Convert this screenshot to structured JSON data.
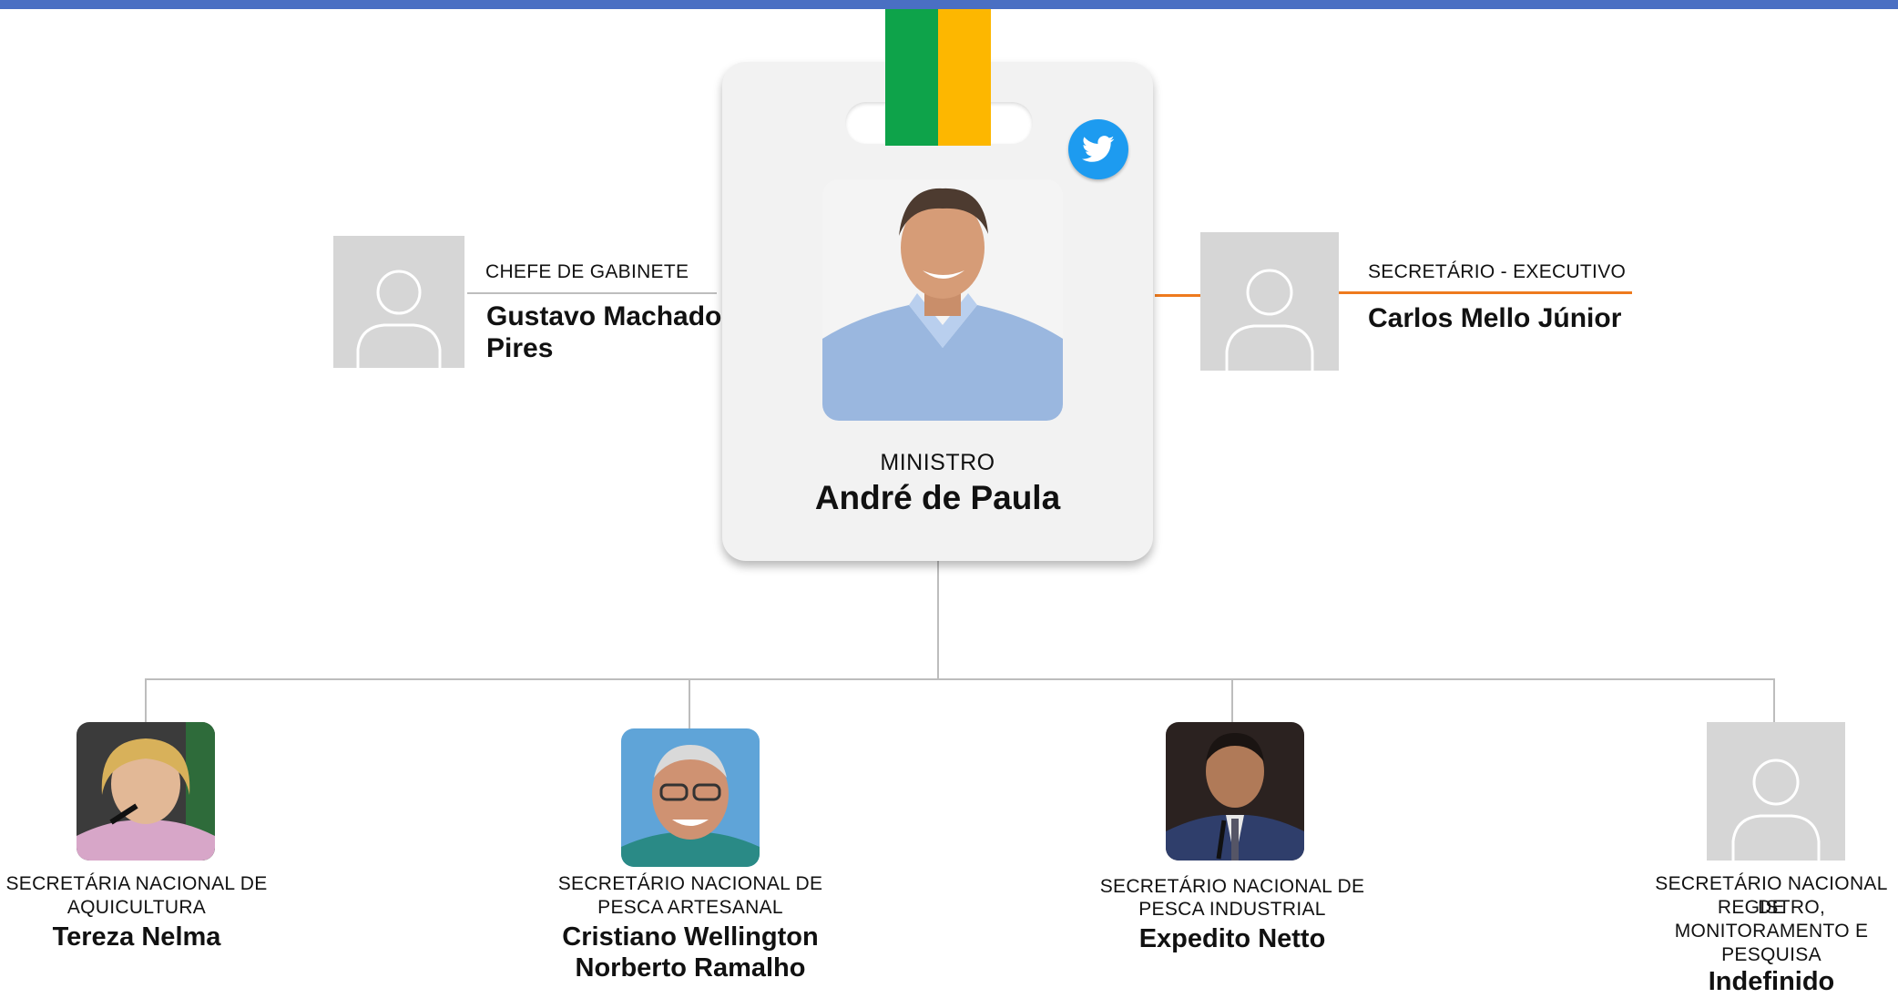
{
  "minister": {
    "role": "MINISTRO",
    "name": "André de Paula"
  },
  "chief_of_staff": {
    "role": "CHEFE DE GABINETE",
    "name_line1": "Gustavo Machado",
    "name_line2": "Pires"
  },
  "executive_secretary": {
    "role": "SECRETÁRIO - EXECUTIVO",
    "name": "Carlos Mello Júnior"
  },
  "secretaries": [
    {
      "role_line1": "SECRETÁRIA NACIONAL DE",
      "role_line2": "AQUICULTURA",
      "name_line1": "Tereza Nelma"
    },
    {
      "role_line1": "SECRETÁRIO NACIONAL DE",
      "role_line2": "PESCA ARTESANAL",
      "name_line1": "Cristiano Wellington",
      "name_line2": "Norberto Ramalho"
    },
    {
      "role_line1": "SECRETÁRIO NACIONAL DE",
      "role_line2": "PESCA INDUSTRIAL",
      "name_line1": "Expedito Netto"
    },
    {
      "role_line1": "SECRETÁRIO NACIONAL DE",
      "role_line2": "REGISTRO,",
      "role_line3": "MONITORAMENTO E",
      "role_line4": "PESQUISA",
      "name_line1": "Indefinido"
    }
  ],
  "icons": {
    "social": "twitter-icon",
    "placeholder": "user-placeholder-icon"
  },
  "colors": {
    "top_bar": "#4a6fc3",
    "strap_green": "#0ea34a",
    "strap_yellow": "#fdb700",
    "accent_line": "#ee7a1e",
    "twitter": "#1d9bf0"
  }
}
